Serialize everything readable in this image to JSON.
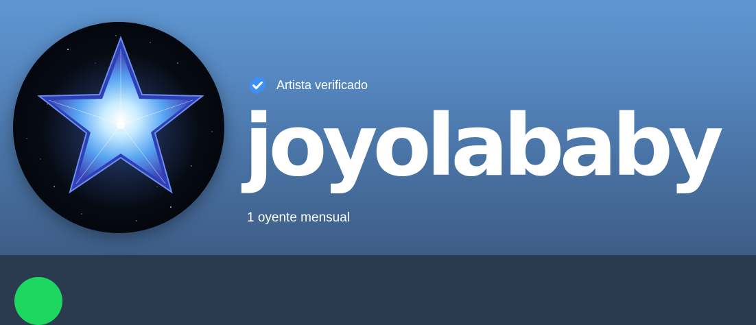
{
  "artist": {
    "verified_label": "Artista verificado",
    "name": "joyolababy",
    "monthly_listeners": "1 oyente mensual"
  },
  "icons": {
    "verified_badge": "verified-check-badge",
    "avatar_image": "glowing-blue-star"
  },
  "colors": {
    "header_gradient_top": "#5e97d2",
    "header_gradient_bottom": "#3d5d86",
    "badge_blue": "#3d91f4",
    "play_green": "#1ed760"
  }
}
